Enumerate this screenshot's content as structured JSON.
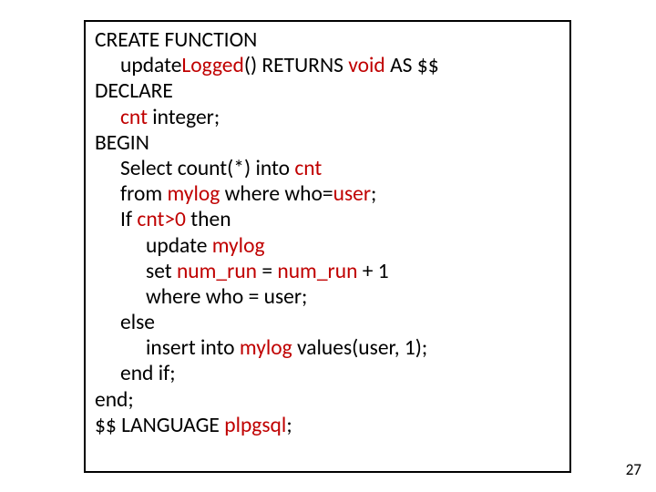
{
  "code": {
    "l1a": "CREATE FUNCTION",
    "l2a": "update",
    "l2b": "Logged",
    "l2c": "() RETURNS ",
    "l2d": "void",
    "l2e": " AS $$",
    "l3": "DECLARE",
    "l4a": "cnt",
    "l4b": " integer;",
    "l5": "BEGIN",
    "l6a": "Select count(*) into ",
    "l6b": "cnt",
    "l7a": "from ",
    "l7b": "mylog",
    "l7c": " where who=",
    "l7d": "user",
    "l7e": ";",
    "l8a": "If ",
    "l8b": "cnt>0",
    "l8c": " then",
    "l9a": "update ",
    "l9b": "mylog",
    "l10a": "set ",
    "l10b": "num_run",
    "l10c": " = ",
    "l10d": "num_run",
    "l10e": " + 1",
    "l11": "where who = user;",
    "l12": "else",
    "l13a": "insert into ",
    "l13b": "mylog",
    "l13c": " values(user, 1);",
    "l14": "end if;",
    "l15": "end;",
    "l16a": "$$ LANGUAGE ",
    "l16b": "plpgsql",
    "l16c": ";"
  },
  "page_number": "27"
}
